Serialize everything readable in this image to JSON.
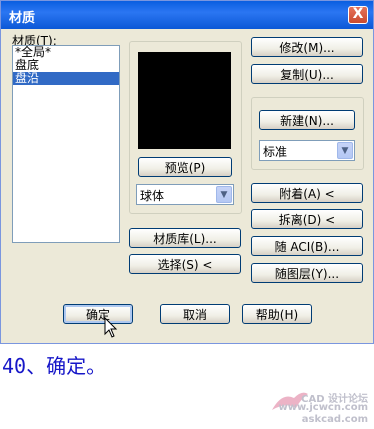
{
  "dialog": {
    "title": "材质",
    "close_label": "X"
  },
  "materials": {
    "label": "材质(T):",
    "items": [
      "*全局*",
      "盘底",
      "盘沿"
    ],
    "selected_index": 2
  },
  "preview": {
    "preview_button": "预览(P)",
    "shape_select": "球体"
  },
  "buttons": {
    "library": "材质库(L)...",
    "select": "选择(S) <",
    "modify": "修改(M)...",
    "duplicate": "复制(U)...",
    "new": "新建(N)...",
    "attach": "附着(A) <",
    "detach": "拆离(D) <",
    "by_aci": "随 ACI(B)...",
    "by_layer": "随图层(Y)...",
    "ok": "确定",
    "cancel": "取消",
    "help": "帮助(H)"
  },
  "type_select": "标准",
  "caption": "40、确定。",
  "watermark": {
    "line1": "CAD 设计论坛",
    "line2": "www.jcwcn.com",
    "line3": "askcad.com"
  }
}
